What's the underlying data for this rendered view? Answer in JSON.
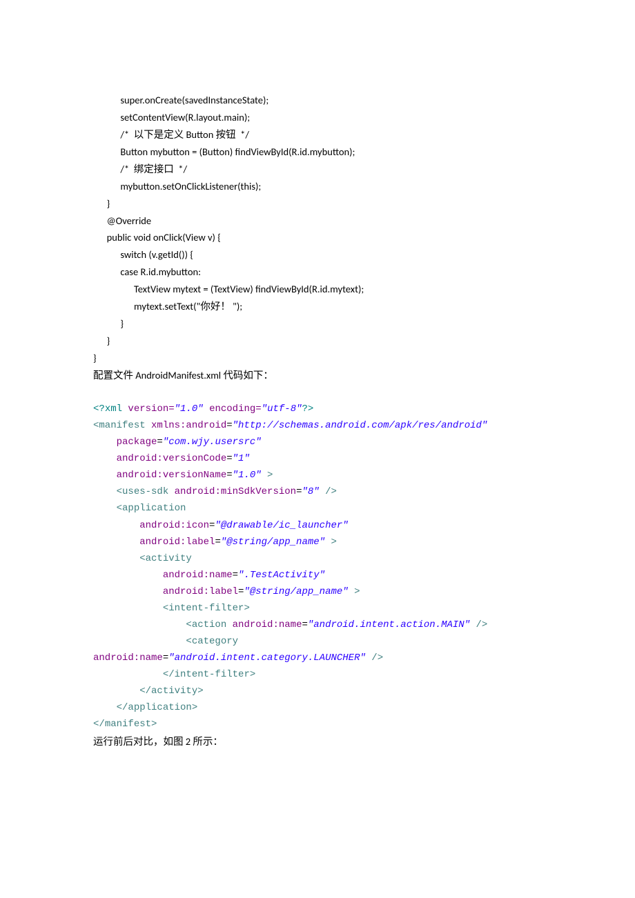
{
  "java": {
    "l1": "            super.onCreate(savedInstanceState);",
    "l2": "            setContentView(R.layout.main);",
    "l3": "            /*  以下是定义 Button 按钮  */",
    "l4": "            Button mybutton = (Button) findViewById(R.id.mybutton);",
    "l5": "            /*  绑定接口  */",
    "l6": "            mybutton.setOnClickListener(this);",
    "l7": "      }",
    "l8": "      @Override",
    "l9": "      public void onClick(View v) {",
    "l10": "            switch (v.getId()) {",
    "l11": "            case R.id.mybutton:",
    "l12": "                  TextView mytext = (TextView) findViewById(R.id.mytext);",
    "l13": "                  mytext.setText(\"你好！ \");",
    "l14": "            }",
    "l15": "      }",
    "l16": "}"
  },
  "para1": "配置文件 AndroidManifest.xml 代码如下：",
  "xml": {
    "l1": {
      "a": "<?",
      "b": "xml",
      "c": " version=",
      "d": "\"1.0\"",
      "e": " encoding=",
      "f": "\"utf-8\"",
      "g": "?>"
    },
    "l2": {
      "a": "<",
      "b": "manifest",
      "c": " xmlns:android",
      "d": "=",
      "e": "\"http://schemas.android.com/apk/res/android\""
    },
    "l3": {
      "a": "    package",
      "b": "=",
      "c": "\"com.wjy.usersrc\""
    },
    "l4": {
      "a": "    android:versionCode",
      "b": "=",
      "c": "\"1\""
    },
    "l5": {
      "a": "    android:versionName",
      "b": "=",
      "c": "\"1.0\"",
      "d": " >"
    },
    "l6": {
      "a": "    <",
      "b": "uses-sdk",
      "c": " android:minSdkVersion",
      "d": "=",
      "e": "\"8\"",
      "f": " />"
    },
    "l7": {
      "a": "    <",
      "b": "application"
    },
    "l8": {
      "a": "        android:icon",
      "b": "=",
      "c": "\"@drawable/ic_launcher\""
    },
    "l9": {
      "a": "        android:label",
      "b": "=",
      "c": "\"@string/app_name\"",
      "d": " >"
    },
    "l10": {
      "a": "        <",
      "b": "activity"
    },
    "l11": {
      "a": "            android:name",
      "b": "=",
      "c": "\".TestActivity\""
    },
    "l12": {
      "a": "            android:label",
      "b": "=",
      "c": "\"@string/app_name\"",
      "d": " >"
    },
    "l13": {
      "a": "            <",
      "b": "intent-filter",
      "c": ">"
    },
    "l14": {
      "a": "                <",
      "b": "action",
      "c": " android:name",
      "d": "=",
      "e": "\"android.intent.action.MAIN\"",
      "f": " />"
    },
    "l15": {
      "a": "                <",
      "b": "category"
    },
    "l16": {
      "a": "android:name",
      "b": "=",
      "c": "\"android.intent.category.LAUNCHER\"",
      "d": " />"
    },
    "l17": {
      "a": "            </",
      "b": "intent-filter",
      "c": ">"
    },
    "l18": {
      "a": "        </",
      "b": "activity",
      "c": ">"
    },
    "l19": {
      "a": "    </",
      "b": "application",
      "c": ">"
    },
    "l20": {
      "a": "</",
      "b": "manifest",
      "c": ">"
    }
  },
  "para2": "运行前后对比，如图 2 所示："
}
